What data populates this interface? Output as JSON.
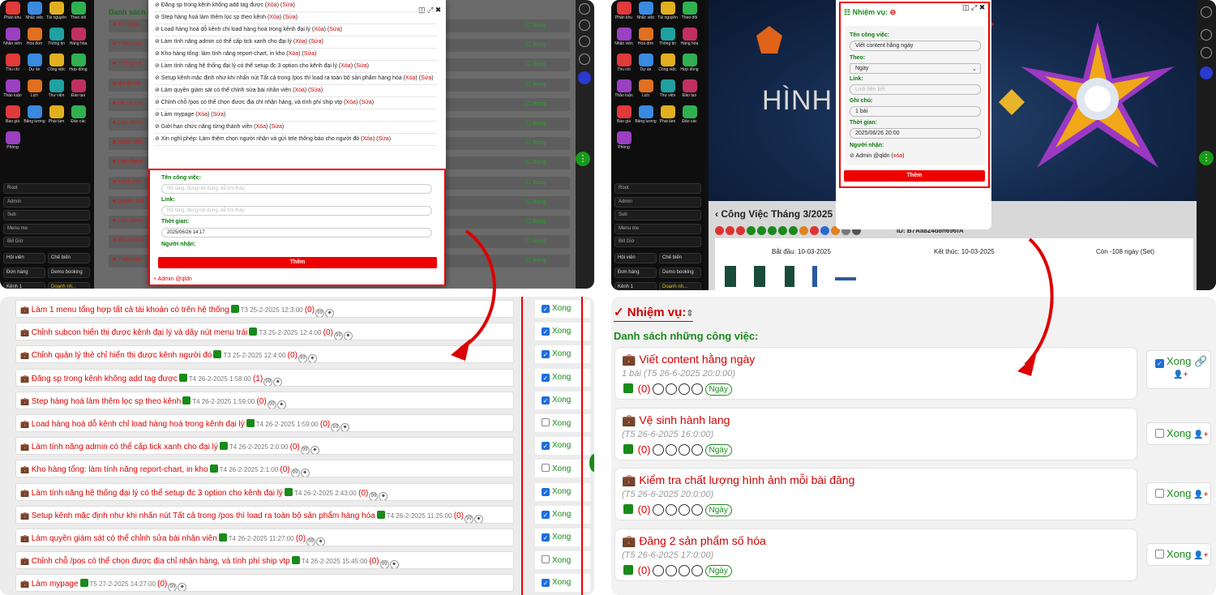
{
  "top_left": {
    "side_icons": [
      "Phân khu",
      "Nhắc việc",
      "Tài nguyên",
      "Theo dõi",
      "Nhân viên",
      "Hóa đơn",
      "Thông tin",
      "Hàng hóa",
      "Thu chi",
      "Dự án",
      "Công việc",
      "Hợp đồng",
      "Thảo luận",
      "Lịch",
      "Thư viện",
      "Đào tạo",
      "Báo giá",
      "Bảng lương",
      "Phái làm",
      "Đảo các",
      "Phòng"
    ],
    "side_buttons": [
      "Root",
      "Admin",
      "Sub",
      "Menu me",
      "Bill Giờ"
    ],
    "side_pairs": [
      [
        "Hội viên",
        "Chế biến"
      ],
      [
        "Đơn hàng",
        "Demo booking"
      ],
      [
        "Kênh 1",
        "Doanh nh..."
      ]
    ],
    "bg_header": "Danh sách nh",
    "bg_rows": [
      "Khi login,",
      "Thêm nút",
      "Thống kê",
      "dự án tới",
      "Hệ số lươ",
      "Làm them",
      "Nhân viên",
      "Làm them",
      "Kênh trên",
      "Quyền thả",
      "Làm them",
      "Bỏ confirm",
      "Thêm nút"
    ],
    "task_list": [
      "Đăng sp trong kênh không add tag được",
      "Step hàng hoá làm thêm lọc sp theo kênh",
      "Load hàng hoá dỗ kênh chỉ load hàng hoá trong kênh đại lý",
      "Làm tính năng admin có thể cấp tick xanh cho đại lý",
      "Kho hàng tổng: làm tính năng report-chart, in kho",
      "Làm tính năng hệ thống đại lý có thể setup đc 3 option cho kênh đại lý",
      "Setup kênh mặc định như khi nhấn nút Tất cả trong /pos thì load ra toàn bộ sản phẩm hàng hóa",
      "Làm quyền giám sát có thể chỉnh sửa bài nhân viên",
      "Chỉnh chỗ /pos có thể chọn được địa chỉ nhận hàng, và tính phí ship vtp",
      "Làm mypage",
      "Giới hạn chức năng từng thành viên",
      "Xin nghỉ phép: Làm thêm chọn người nhận và gửi tele thông báo cho người đó"
    ],
    "del": "Xóa",
    "edit": "Sửa",
    "form": {
      "name_label": "Tên công việc:",
      "name_ph": "Rõ ràng, đúng nội dung, dễ tìm thấy",
      "link_label": "Link:",
      "link_ph": "Rõ ràng, đúng nội dung, dễ tìm thấy",
      "time_label": "Thời gian:",
      "time_value": "2025/06/26 14:17",
      "recv_label": "Người nhận:",
      "submit": "Thêm",
      "footer": "+ Admin @qldn"
    }
  },
  "bottom_left": {
    "xong": "Xong",
    "rows": [
      {
        "title": "Làm 1 menu tổng hợp tất cả tài khoản có trên hệ thống",
        "time": "T3 25-2-2025 12:3:00",
        "count": "(0)",
        "checked": true
      },
      {
        "title": "Chỉnh subcon hiển thị được kênh đại lý và dãy nút menu trái",
        "time": "T3 25-2-2025 12:4:00",
        "count": "(0)",
        "checked": true
      },
      {
        "title": "Chỉnh quản lý thẻ chỉ hiển thị được kênh người đó",
        "time": "T3 25-2-2025 12:4:00",
        "count": "(0)",
        "checked": true
      },
      {
        "title": "Đăng sp trong kênh không add tag được",
        "time": "T4 26-2-2025 1:58:00",
        "count": "(1)",
        "checked": true
      },
      {
        "title": "Step hàng hoá làm thêm lọc sp theo kênh",
        "time": "T4 26-2-2025 1:59:00",
        "count": "(0)",
        "checked": true
      },
      {
        "title": "Load hàng hoá dỗ kênh chỉ load hàng hoá trong kênh đại lý",
        "time": "T4 26-2-2025 1:59:00",
        "count": "(0)",
        "checked": false
      },
      {
        "title": "Làm tính năng admin có thể cấp tick xanh cho đại lý",
        "time": "T4 26-2-2025 2:0:00",
        "count": "(0)",
        "checked": true
      },
      {
        "title": "Kho hàng tổng: làm tính năng report-chart, in kho",
        "time": "T4 26-2-2025 2:1:00",
        "count": "(0)",
        "checked": false
      },
      {
        "title": "Làm tính năng hệ thống đại lý có thể setup đc 3 option cho kênh đại lý",
        "time": "T4 26-2-2025 2:43:00",
        "count": "(0)",
        "checked": true
      },
      {
        "title": "Setup kênh mặc định như khi nhấn nút Tất cả trong /pos thì load ra toàn bộ sản phẩm hàng hóa",
        "time": "T4 26-2-2025 11:25:00",
        "count": "(0)",
        "checked": true
      },
      {
        "title": "Làm quyền giám sát có thể chỉnh sửa bài nhân viên",
        "time": "T4 26-2-2025 11:27:00",
        "count": "(0)",
        "checked": true
      },
      {
        "title": "Chỉnh chỗ /pos có thể chọn được địa chỉ nhận hàng, và tính phí ship vtp",
        "time": "T4 26-2-2025 15:45:00",
        "count": "(0)",
        "checked": false
      },
      {
        "title": "Làm mypage",
        "time": "T5 27-2-2025 14:27:00",
        "count": "(0)",
        "checked": true
      }
    ]
  },
  "top_right": {
    "game_text": "HÌNH",
    "card_title": "Công Việc Tháng 3/2025",
    "card_id": "ID: B7Aa824d8h696fA",
    "start": "Bắt đầu: 10-03-2025",
    "end": "Kết thúc: 10-03-2025",
    "remain": "Còn -108 ngày (Set)",
    "modal": {
      "title": "Nhiệm vụ:",
      "name_label": "Tên công việc:",
      "name_value": "Viết content hằng ngày",
      "theo_label": "Theo:",
      "theo_value": "Ngày",
      "link_label": "Link:",
      "link_ph": "Link liên kết",
      "note_label": "Ghi chú:",
      "note_value": "1 bài",
      "time_label": "Thời gian:",
      "time_value": "2025/06/26 20:00",
      "recv_label": "Người nhận:",
      "recv_value": "Admin @qldn",
      "recv_del": "xóa",
      "submit": "Thêm"
    }
  },
  "bottom_right": {
    "title": "Nhiệm vụ:",
    "list_title": "Danh sách những công việc:",
    "xong": "Xong",
    "tag": "Ngày",
    "tasks": [
      {
        "title": "Viết content hằng ngày",
        "sub": "1 bài (T5 26-6-2025 20:0:00)",
        "count": "(0)",
        "checked": true
      },
      {
        "title": "Vệ sinh hành lang",
        "sub": "(T5 26-6-2025 16:0:00)",
        "count": "(0)",
        "checked": false
      },
      {
        "title": "Kiểm tra chất lượng hình ảnh mỗi bài đăng",
        "sub": "(T5 26-6-2025 20:0:00)",
        "count": "(0)",
        "checked": false
      },
      {
        "title": "Đăng 2 sản phẩm số hóa",
        "sub": "(T5 26-6-2025 17:0:00)",
        "count": "(0)",
        "checked": false
      }
    ]
  },
  "colors": {
    "accent_red": "#e00000",
    "green": "#1a8a1a",
    "checkbox_blue": "#1e6fd9"
  }
}
